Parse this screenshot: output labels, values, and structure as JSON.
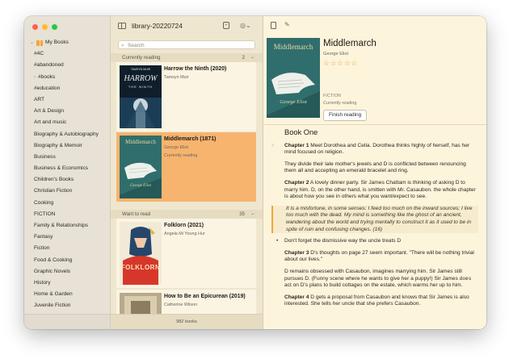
{
  "window": {
    "library_name": "library-20220724"
  },
  "sidebar": {
    "root_label": "My Books",
    "items": [
      "#4C",
      "#abandoned",
      "#books",
      "#education",
      "ART",
      "Art & Design",
      "Art and music",
      "Biography & Autobiography",
      "Biography & Memoir",
      "Business",
      "Business & Economics",
      "Children's Books",
      "Christian Fiction",
      "Cooking",
      "FICTION",
      "Family & Relationships",
      "Fantasy",
      "Fiction",
      "Food & Cooking",
      "Graphic Novels",
      "History",
      "Home & Garden",
      "Juvenile Fiction"
    ]
  },
  "search": {
    "placeholder": "Search"
  },
  "sections": {
    "reading": {
      "label": "Currently reading",
      "count": "2"
    },
    "want": {
      "label": "Want to read",
      "count": "35"
    }
  },
  "books": [
    {
      "title": "Harrow the Ninth (2020)",
      "author": "Tamsyn Muir",
      "status": "Currently reading",
      "cover_text": "HARROW",
      "cover_sub": "THE NINTH",
      "cover_top": "TAMSYN MUIR"
    },
    {
      "title": "Middlemarch (1871)",
      "author": "George Eliot",
      "status": "Currently reading",
      "cover_text": "Middlemarch",
      "cover_sub": "George Eliot"
    },
    {
      "title": "Folklorn (2021)",
      "author": "Angela Mi Young Hur",
      "status": "",
      "cover_text": "FOLKLORN"
    },
    {
      "title": "How to Be an Epicurean (2019)",
      "author": "Catherine Wilson",
      "status": ""
    }
  ],
  "footer": {
    "count": "982 books"
  },
  "detail": {
    "title": "Middlemarch",
    "author": "George Eliot",
    "stars": "☆☆☆☆☆",
    "genre": "FICTION",
    "status": "Currently reading",
    "button": "Finish reading",
    "cover_title": "Middlemarch",
    "cover_author": "George Eliot"
  },
  "notes": {
    "heading": "Book One",
    "ch1_label": "Chapter 1",
    "ch1_text": "Meet Dorothea and Celia. Dorothea thinks highly of herself, has her mind focused on religion.",
    "p2": "They divide their late mother's jewels and D is conflicted between renouncing them all and accepting an emerald bracelet and ring.",
    "ch2_label": "Chapter 2",
    "ch2_text": "A lovely dinner party. Sir James Chattam is thinking of asking D to marry him. D, on the other hand, is smitten with Mr. Casaubon. the whole chapter is about how you see in others what you want/expect to see.",
    "quote": "It is a misfortune, in some senses: I feed too much on the inward sources; I live too much with the dead. My mind is something like the ghost of an ancient, wandering about the world and trying mentally to construct it as it used to be in spite of ruin and confusing changes. (16)",
    "bullet": "Don't forget the dismissive way the uncle treats D",
    "ch3_label": "Chapter 3",
    "ch3_text": "D's thoughts on page 27 seem important. \"There will be nothing trivial about our lives.\"",
    "p5a": "D remains obsessed with Casaubon, imagines marrying him. Sir James still pursues D. (Funny scene where he wants to give her a puppy!) Sir James",
    "p5_code": "does",
    "p5b": "act on D's plans to build cottages on the estate, which warms her up to him.",
    "ch4_label": "Chapter 4",
    "ch4_text": "D gets a proposal from Casaubon and knows that Sir James is also interested. She tells her uncle that she prefers Casaubon."
  }
}
